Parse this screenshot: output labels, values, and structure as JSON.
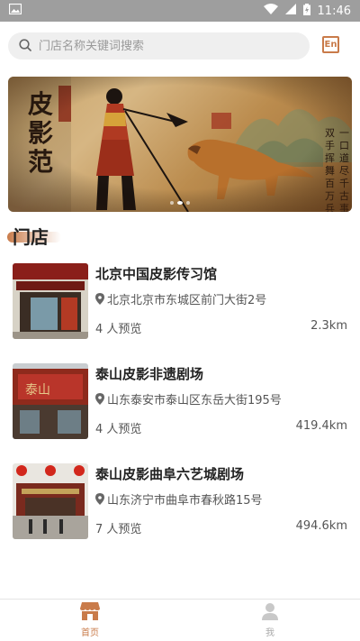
{
  "status_bar": {
    "time": "11:46"
  },
  "search": {
    "placeholder": "门店名称关键词搜索"
  },
  "lang_button": {
    "label": "En"
  },
  "banner": {
    "title_text": "皮影范",
    "poem_text": "一口道尽千古事 双手挥舞百万兵"
  },
  "section": {
    "title": "门店"
  },
  "stores": [
    {
      "name": "北京中国皮影传习馆",
      "address": "北京北京市东城区前门大街2号",
      "views": "4 人预览",
      "distance": "2.3km"
    },
    {
      "name": "泰山皮影非遗剧场",
      "address": "山东泰安市泰山区东岳大街195号",
      "views": "4 人预览",
      "distance": "419.4km"
    },
    {
      "name": "泰山皮影曲阜六艺城剧场",
      "address": "山东济宁市曲阜市春秋路15号",
      "views": "7 人预览",
      "distance": "494.6km"
    }
  ],
  "tabbar": {
    "home_label": "首页",
    "me_label": "我"
  },
  "colors": {
    "accent": "#c97b4a",
    "status_bar": "#9e9e9e"
  }
}
